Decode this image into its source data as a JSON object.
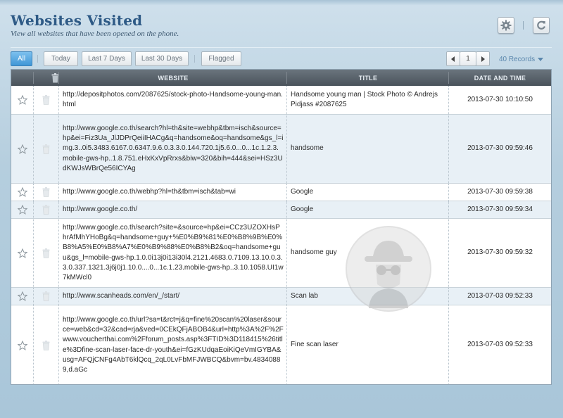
{
  "header": {
    "title": "Websites Visited",
    "subtitle": "View all websites that have been opened on the phone.",
    "settings_icon": "gear-icon",
    "refresh_icon": "refresh-icon"
  },
  "filters": {
    "all": "All",
    "today": "Today",
    "last7": "Last 7 Days",
    "last30": "Last 30 Days",
    "flagged": "Flagged",
    "active": "All"
  },
  "pager": {
    "page": "1",
    "records": "40 Records"
  },
  "table": {
    "columns": [
      "WEBSITE",
      "TITLE",
      "DATE AND TIME"
    ],
    "rows": [
      {
        "website": "http://depositphotos.com/2087625/stock-photo-Handsome-young-man.html",
        "title": "Handsome young man | Stock Photo © Andrejs Pidjass #2087625",
        "datetime": "2013-07-30 10:10:50"
      },
      {
        "website": "http://www.google.co.th/search?hl=th&site=webhp&tbm=isch&source=hp&ei=Fiz3Ua_JlJDPrQeiiIHACg&q=handsome&oq=handsome&gs_l=img.3..0i5.3483.6167.0.6347.9.6.0.3.3.0.144.720.1j5.6.0...0...1c.1.2.3.mobile-gws-hp..1.8.751.eHxKxVpRrxs&biw=320&bih=444&sei=HSz3UdKWJsWBrQe56ICYAg",
        "title": "handsome",
        "datetime": "2013-07-30 09:59:46"
      },
      {
        "website": "http://www.google.co.th/webhp?hl=th&tbm=isch&tab=wi",
        "title": "Google",
        "datetime": "2013-07-30 09:59:38"
      },
      {
        "website": "http://www.google.co.th/",
        "title": "Google",
        "datetime": "2013-07-30 09:59:34"
      },
      {
        "website": "http://www.google.co.th/search?site=&source=hp&ei=CCz3UZOXHsPhrAfMhYHoBg&q=handsome+guy+%E0%B9%81%E0%B8%9B%E0%B8%A5%E0%B8%A7%E0%B9%88%E0%B8%B2&oq=handsome+guu&gs_l=mobile-gws-hp.1.0.0i13j0i13i30l4.2121.4683.0.7109.13.10.0.3.3.0.337.1321.3j6j0j1.10.0....0...1c.1.23.mobile-gws-hp..3.10.1058.UI1w7kMWcl0",
        "title": "handsome guy",
        "datetime": "2013-07-30 09:59:32"
      },
      {
        "website": "http://www.scanheads.com/en/_/start/",
        "title": "Scan lab",
        "datetime": "2013-07-03 09:52:33"
      },
      {
        "website": "http://www.google.co.th/url?sa=t&rct=j&q=fine%20scan%20laser&source=web&cd=32&cad=rja&ved=0CEkQFjABOB4&url=http%3A%2F%2Fwww.voucherthai.com%2Fforum_posts.asp%3FTID%3D118415%26title%3Dfine-scan-laser-face-dr-youth&ei=fGzKUdqaEoiKiQeVmIGYBA&usg=AFQjCNFg4AbT6klQcq_2qL0LvFbMFJWBCQ&bvm=bv.48340889,d.aGc",
        "title": "Fine scan laser",
        "datetime": "2013-07-03 09:52:33"
      }
    ]
  }
}
